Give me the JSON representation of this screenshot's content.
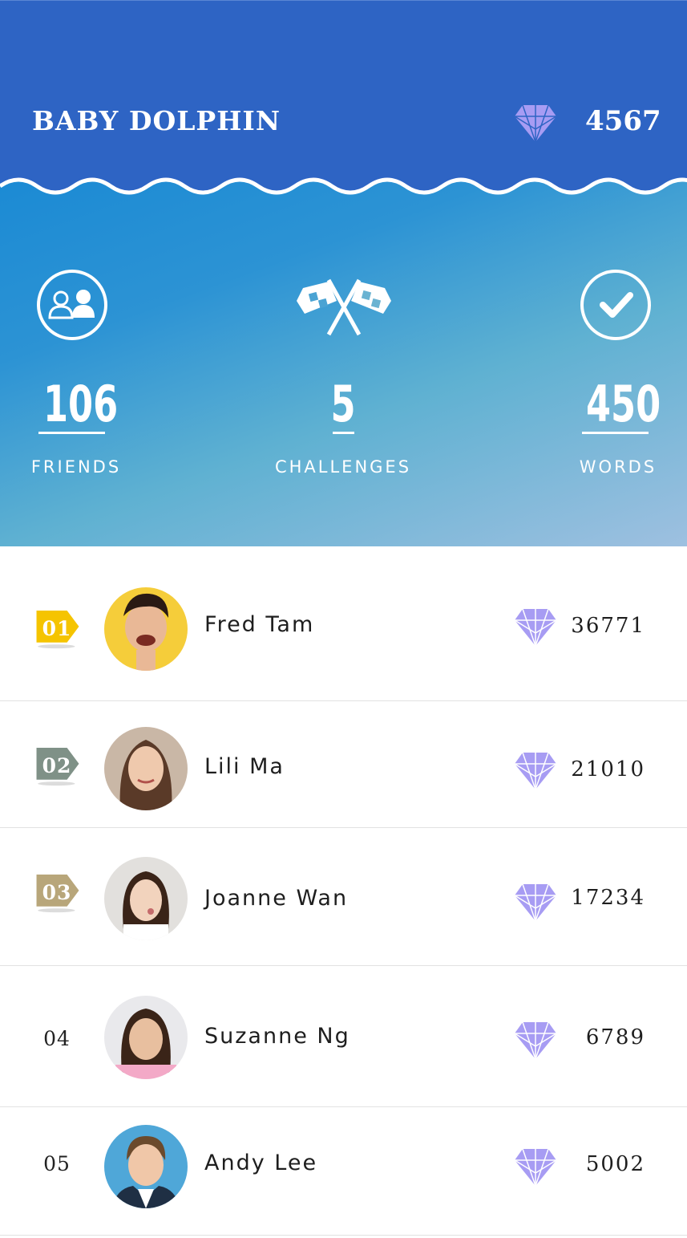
{
  "header": {
    "title": "BABY DOLPHIN",
    "gem_icon": "diamond-icon",
    "score": "4567",
    "bg_color": "#2e64c4"
  },
  "stats": [
    {
      "icon": "friends-icon",
      "value": "106",
      "label": "FRIENDS"
    },
    {
      "icon": "crossed-flags-icon",
      "value": "5",
      "label": "CHALLENGES"
    },
    {
      "icon": "check-circle-icon",
      "value": "450",
      "label": "WORDS"
    }
  ],
  "leaderboard": [
    {
      "rank": "01",
      "tag_color": "#f5c400",
      "name": "Fred Tam",
      "score": "36771",
      "avatar_bg": "#f5cd3a"
    },
    {
      "rank": "02",
      "tag_color": "#7f9187",
      "name": "Lili Ma",
      "score": "21010",
      "avatar_bg": "#c9b7a6"
    },
    {
      "rank": "03",
      "tag_color": "#b8a67a",
      "name": "Joanne Wan",
      "score": "17234",
      "avatar_bg": "#e2e0dd"
    },
    {
      "rank": "04",
      "name": "Suzanne Ng",
      "score": "6789",
      "avatar_bg": "#e9e9ec"
    },
    {
      "rank": "05",
      "name": "Andy Lee",
      "score": "5002",
      "avatar_bg": "#4fa7d8"
    }
  ],
  "gem_color": "#a79cf3"
}
